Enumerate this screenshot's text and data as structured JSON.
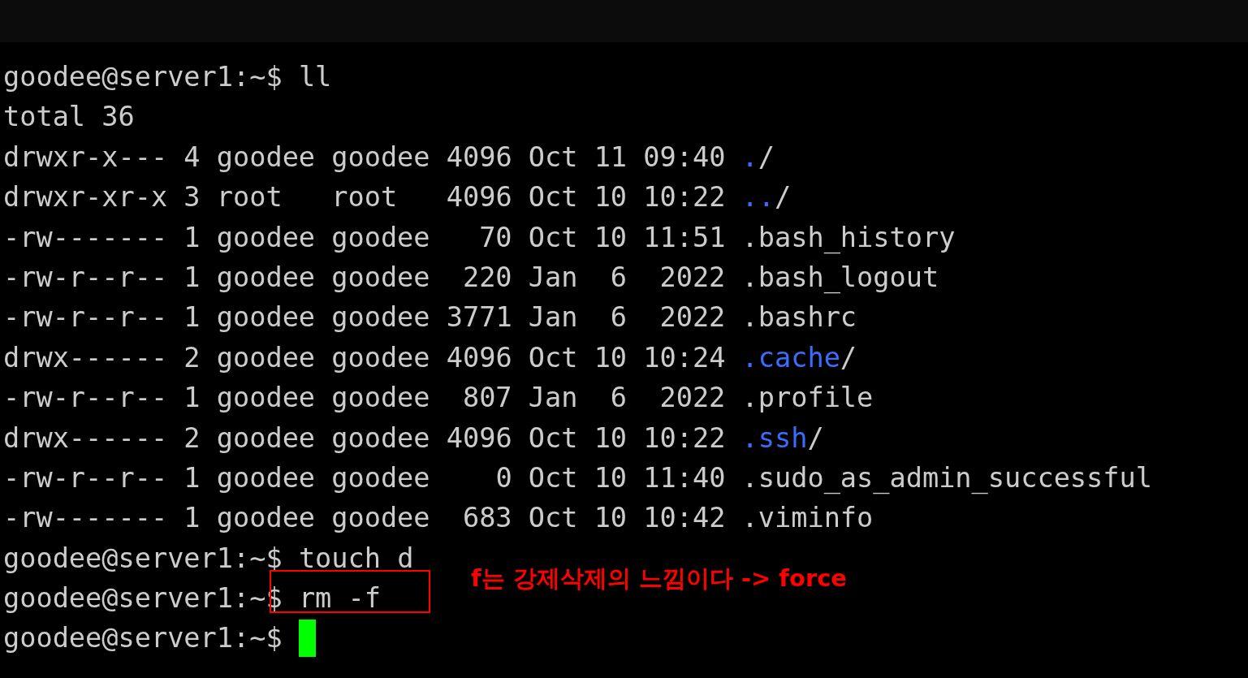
{
  "terminal": {
    "lines": [
      {
        "kind": "prompt",
        "prompt": "goodee@server1:~$",
        "command": "ll"
      },
      {
        "kind": "text",
        "text": "total 36"
      },
      {
        "kind": "entry",
        "perms": "drwxr-x---",
        "links": "4",
        "owner": "goodee",
        "group": "goodee",
        "size": "4096",
        "month": "Oct",
        "day": "11",
        "time": "09:40",
        "name": ".",
        "suffix": "/",
        "directory": true
      },
      {
        "kind": "entry",
        "perms": "drwxr-xr-x",
        "links": "3",
        "owner": "root",
        "group": "root",
        "size": "4096",
        "month": "Oct",
        "day": "10",
        "time": "10:22",
        "name": "..",
        "suffix": "/",
        "directory": true
      },
      {
        "kind": "entry",
        "perms": "-rw-------",
        "links": "1",
        "owner": "goodee",
        "group": "goodee",
        "size": "70",
        "month": "Oct",
        "day": "10",
        "time": "11:51",
        "name": ".bash_history",
        "directory": false
      },
      {
        "kind": "entry",
        "perms": "-rw-r--r--",
        "links": "1",
        "owner": "goodee",
        "group": "goodee",
        "size": "220",
        "month": "Jan",
        "day": "6",
        "time": "2022",
        "name": ".bash_logout",
        "directory": false
      },
      {
        "kind": "entry",
        "perms": "-rw-r--r--",
        "links": "1",
        "owner": "goodee",
        "group": "goodee",
        "size": "3771",
        "month": "Jan",
        "day": "6",
        "time": "2022",
        "name": ".bashrc",
        "directory": false
      },
      {
        "kind": "entry",
        "perms": "drwx------",
        "links": "2",
        "owner": "goodee",
        "group": "goodee",
        "size": "4096",
        "month": "Oct",
        "day": "10",
        "time": "10:24",
        "name": ".cache",
        "suffix": "/",
        "directory": true
      },
      {
        "kind": "entry",
        "perms": "-rw-r--r--",
        "links": "1",
        "owner": "goodee",
        "group": "goodee",
        "size": "807",
        "month": "Jan",
        "day": "6",
        "time": "2022",
        "name": ".profile",
        "directory": false
      },
      {
        "kind": "entry",
        "perms": "drwx------",
        "links": "2",
        "owner": "goodee",
        "group": "goodee",
        "size": "4096",
        "month": "Oct",
        "day": "10",
        "time": "10:22",
        "name": ".ssh",
        "suffix": "/",
        "directory": true
      },
      {
        "kind": "entry",
        "perms": "-rw-r--r--",
        "links": "1",
        "owner": "goodee",
        "group": "goodee",
        "size": "0",
        "month": "Oct",
        "day": "10",
        "time": "11:40",
        "name": ".sudo_as_admin_successful",
        "directory": false
      },
      {
        "kind": "entry",
        "perms": "-rw-------",
        "links": "1",
        "owner": "goodee",
        "group": "goodee",
        "size": "683",
        "month": "Oct",
        "day": "10",
        "time": "10:42",
        "name": ".viminfo",
        "directory": false
      },
      {
        "kind": "prompt",
        "prompt": "goodee@server1:~$",
        "command": "touch d"
      },
      {
        "kind": "prompt",
        "prompt": "goodee@server1:~$",
        "command": "rm -f",
        "highlighted": true,
        "annotation": "f는 강제삭제의 느낌이다 -> force"
      },
      {
        "kind": "prompt",
        "prompt": "goodee@server1:~$",
        "cursor": true
      }
    ]
  }
}
